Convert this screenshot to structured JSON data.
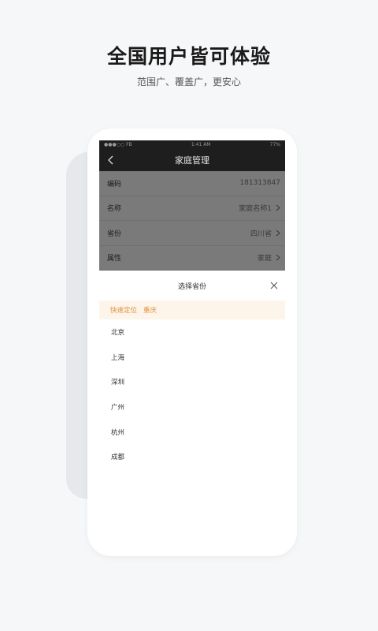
{
  "promo": {
    "headline": "全国用户皆可体验",
    "subline": "范围广、覆盖广，更安心"
  },
  "status_bar": {
    "left": "●●●○○ FB",
    "time": "1:41 AM",
    "battery": "77%"
  },
  "nav": {
    "title": "家庭管理"
  },
  "info_rows": [
    {
      "label": "编码",
      "value": "181313847",
      "chevron": false
    },
    {
      "label": "名称",
      "value": "家庭名称1",
      "chevron": true
    },
    {
      "label": "省份",
      "value": "四川省",
      "chevron": true
    },
    {
      "label": "属性",
      "value": "家庭",
      "chevron": true
    }
  ],
  "sheet": {
    "title": "选择省份",
    "locate_label": "快速定位",
    "locate_city": "重庆",
    "cities": [
      "北京",
      "上海",
      "深圳",
      "广州",
      "杭州",
      "成都"
    ]
  },
  "colors": {
    "accent": "#e0913d",
    "nav_bg": "#1e1e1e",
    "overlay": "#7a7a7a"
  }
}
